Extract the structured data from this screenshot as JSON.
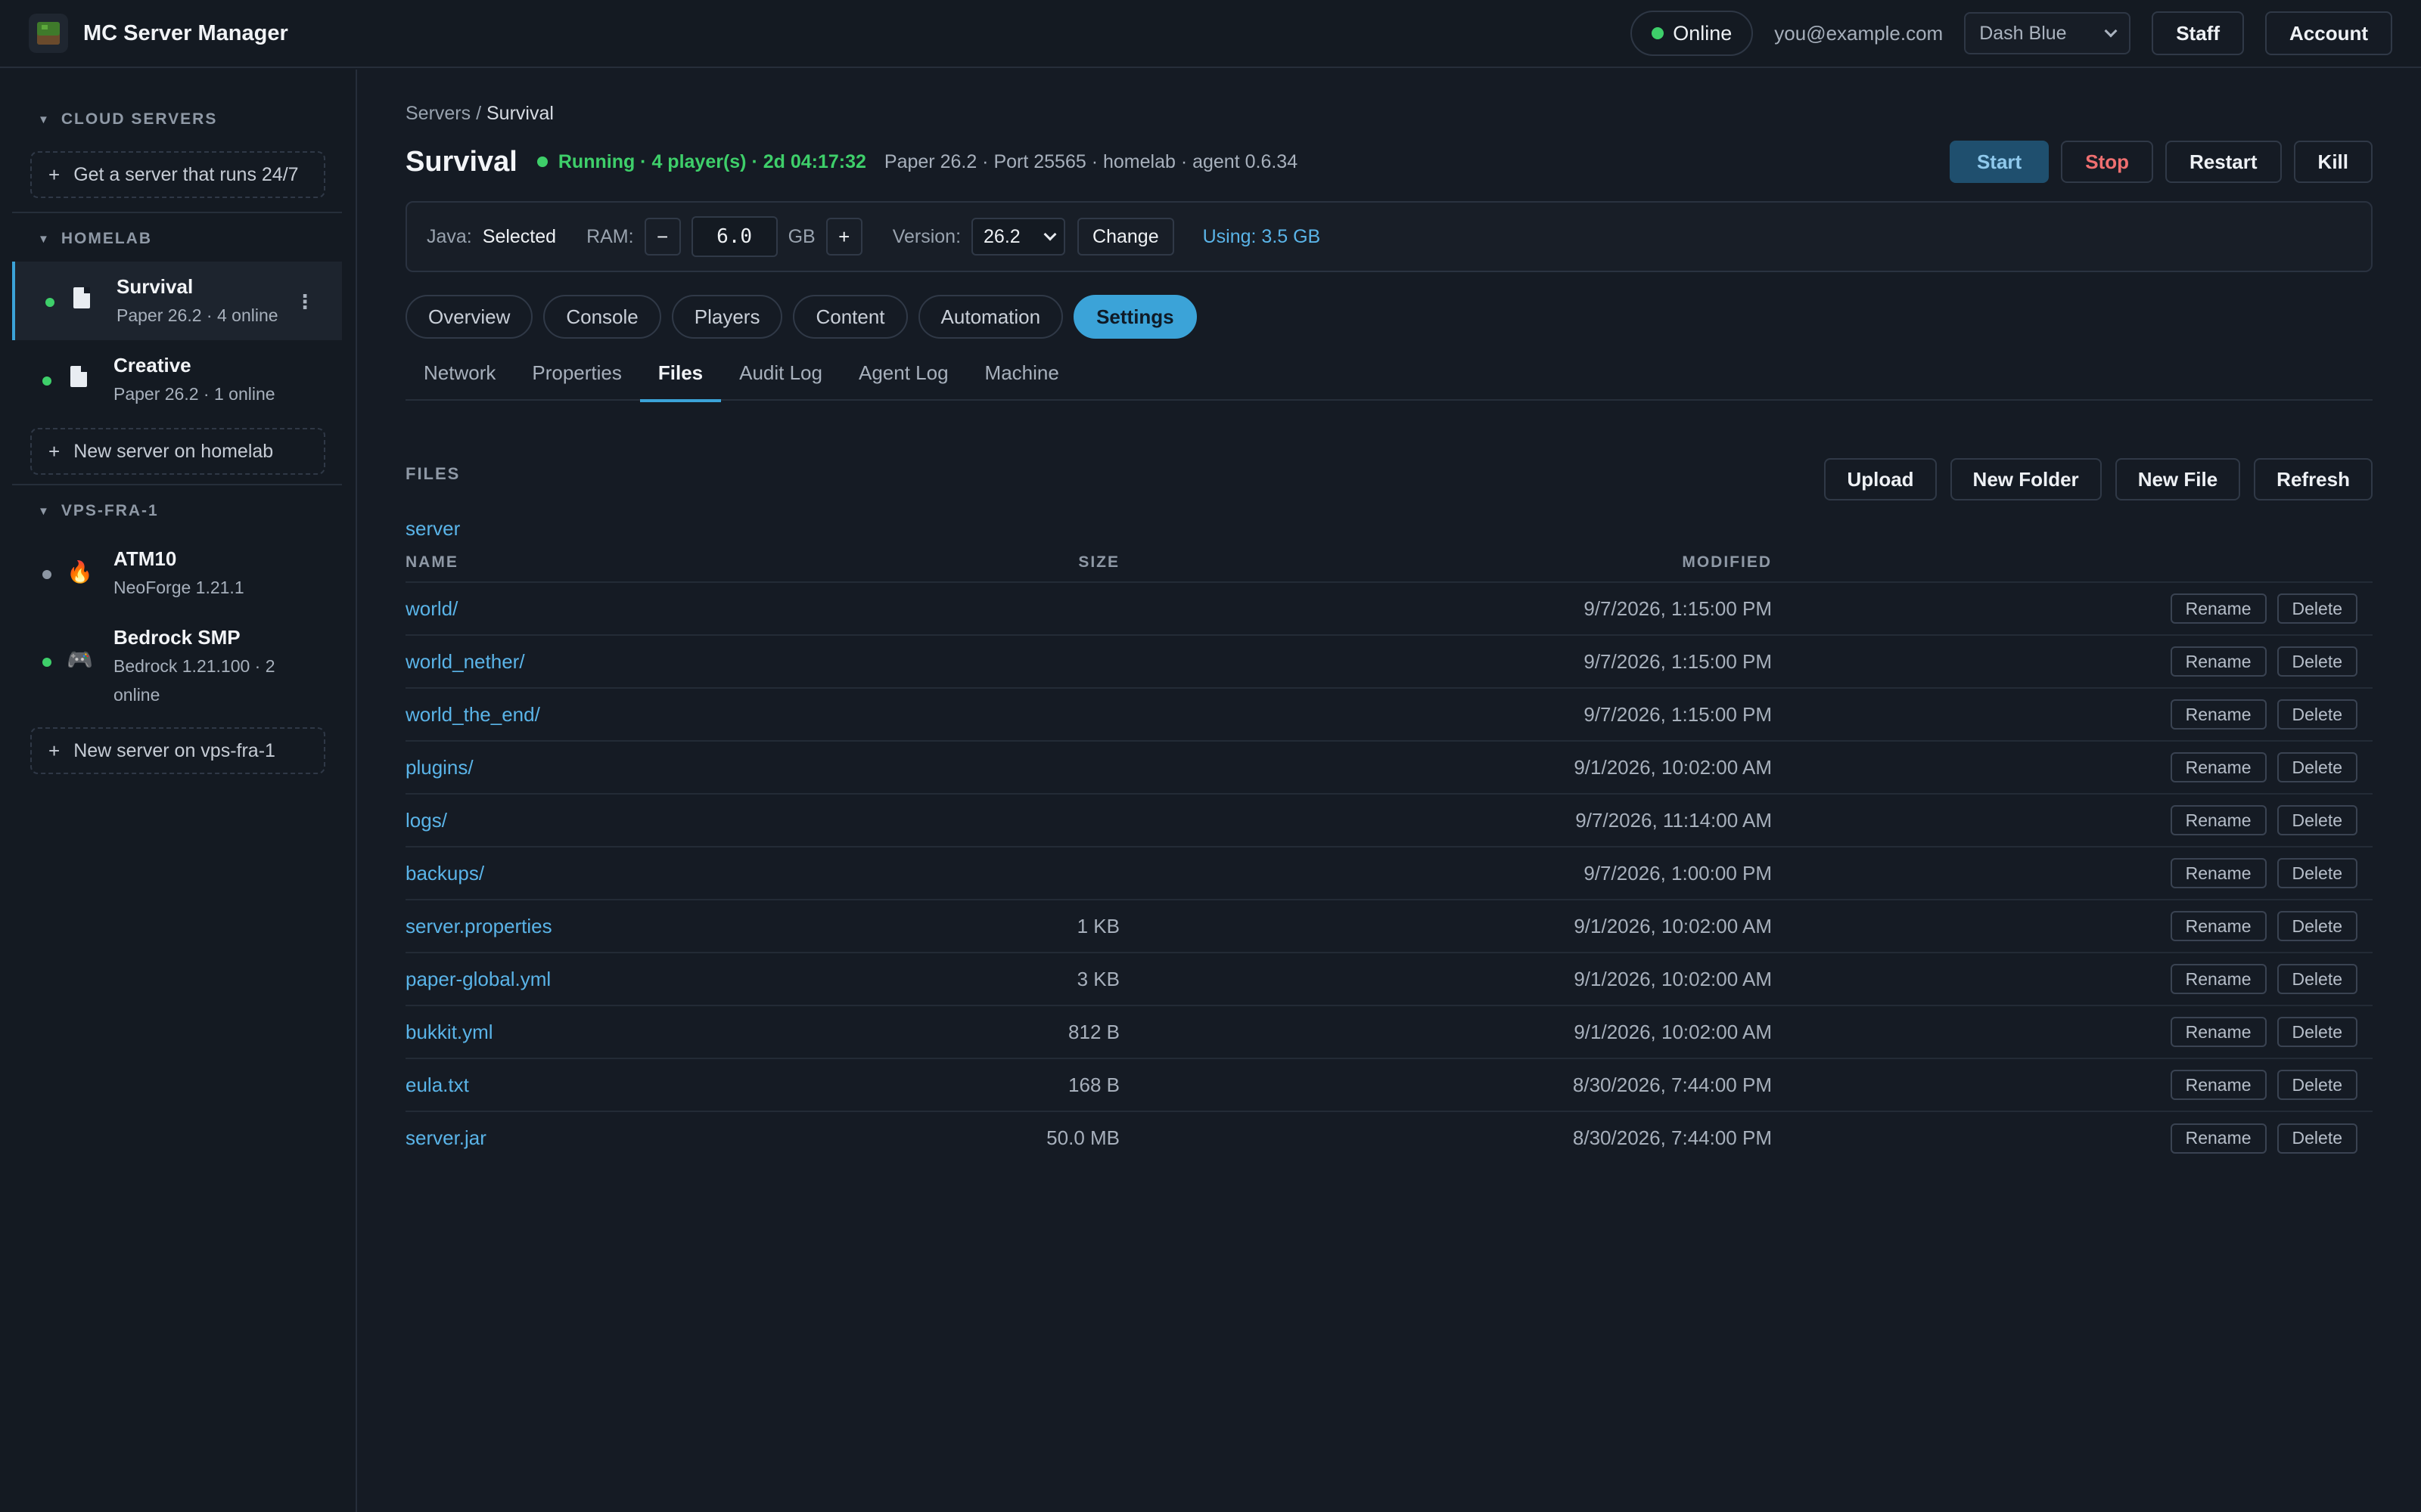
{
  "topbar": {
    "app_title": "MC Server Manager",
    "status": "Online",
    "user_email": "you@example.com",
    "theme": "Dash Blue",
    "staff_label": "Staff",
    "account_label": "Account"
  },
  "sidebar": {
    "cloud": {
      "label": "CLOUD SERVERS",
      "cta": "Get a server that runs 24/7"
    },
    "homelab": {
      "label": "HOMELAB",
      "servers": [
        {
          "name": "Survival",
          "meta": "Paper 26.2 · 4 online",
          "status": "online",
          "icon": "file-icon"
        },
        {
          "name": "Creative",
          "meta": "Paper 26.2 · 1 online",
          "status": "online",
          "icon": "file-icon"
        }
      ],
      "new_label": "New server on homelab"
    },
    "vps": {
      "label": "VPS-FRA-1",
      "servers": [
        {
          "name": "ATM10",
          "meta": "NeoForge 1.21.1",
          "status": "offline",
          "icon": "fire-icon"
        },
        {
          "name": "Bedrock SMP",
          "meta_line1": "Bedrock 1.21.100 · 2",
          "meta_line2": "online",
          "status": "online",
          "icon": "gamepad-icon"
        }
      ],
      "new_label": "New server on vps-fra-1"
    }
  },
  "main": {
    "breadcrumb": {
      "root": "Servers",
      "sep": "/",
      "current": "Survival"
    },
    "title": "Survival",
    "run_status": "Running · 4 player(s) · 2d 04:17:32",
    "server_info": "Paper 26.2 · Port 25565 · homelab · agent 0.6.34",
    "actions": {
      "start": "Start",
      "stop": "Stop",
      "restart": "Restart",
      "kill": "Kill"
    },
    "java_bar": {
      "java_label": "Java:",
      "java_value": "Selected",
      "ram_label": "RAM:",
      "ram_minus": "−",
      "ram_value": "6.0",
      "ram_unit": "GB",
      "ram_plus": "+",
      "version_label": "Version:",
      "version_value": "26.2",
      "change_label": "Change",
      "using": "Using: 3.5 GB"
    },
    "tabs": [
      "Overview",
      "Console",
      "Players",
      "Content",
      "Automation",
      "Settings"
    ],
    "subtabs": [
      "Network",
      "Properties",
      "Files",
      "Audit Log",
      "Agent Log",
      "Machine"
    ],
    "files": {
      "heading": "FILES",
      "actions": {
        "upload": "Upload",
        "new_folder": "New Folder",
        "new_file": "New File",
        "refresh": "Refresh"
      },
      "path": "server",
      "columns": {
        "name": "NAME",
        "size": "SIZE",
        "modified": "MODIFIED"
      },
      "row_actions": {
        "rename": "Rename",
        "delete": "Delete"
      },
      "rows": [
        {
          "name": "world/",
          "size": "",
          "modified": "9/7/2026, 1:15:00 PM"
        },
        {
          "name": "world_nether/",
          "size": "",
          "modified": "9/7/2026, 1:15:00 PM"
        },
        {
          "name": "world_the_end/",
          "size": "",
          "modified": "9/7/2026, 1:15:00 PM"
        },
        {
          "name": "plugins/",
          "size": "",
          "modified": "9/1/2026, 10:02:00 AM"
        },
        {
          "name": "logs/",
          "size": "",
          "modified": "9/7/2026, 11:14:00 AM"
        },
        {
          "name": "backups/",
          "size": "",
          "modified": "9/7/2026, 1:00:00 PM"
        },
        {
          "name": "server.properties",
          "size": "1 KB",
          "modified": "9/1/2026, 10:02:00 AM"
        },
        {
          "name": "paper-global.yml",
          "size": "3 KB",
          "modified": "9/1/2026, 10:02:00 AM"
        },
        {
          "name": "bukkit.yml",
          "size": "812 B",
          "modified": "9/1/2026, 10:02:00 AM"
        },
        {
          "name": "eula.txt",
          "size": "168 B",
          "modified": "8/30/2026, 7:44:00 PM"
        },
        {
          "name": "server.jar",
          "size": "50.0 MB",
          "modified": "8/30/2026, 7:44:00 PM"
        }
      ]
    }
  },
  "colors": {
    "accent": "#3ba3d8",
    "online": "#3ecf6a",
    "stop": "#ef6f70",
    "link": "#5ab4e8"
  }
}
